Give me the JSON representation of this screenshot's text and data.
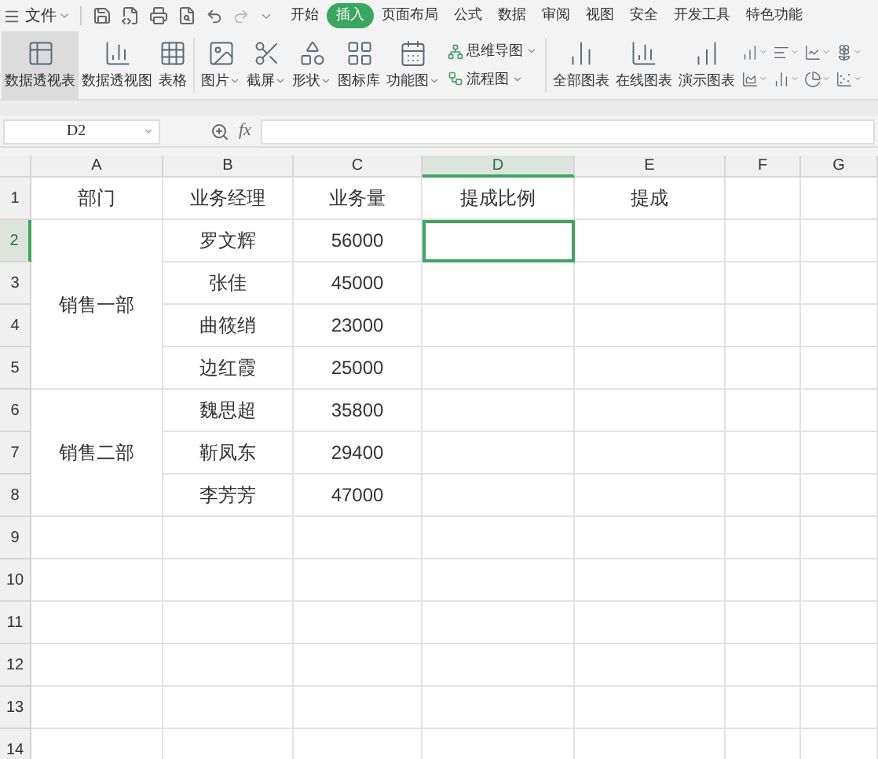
{
  "menu": {
    "file_label": "文件",
    "tabs": [
      {
        "label": "开始",
        "selected": false
      },
      {
        "label": "插入",
        "selected": true
      },
      {
        "label": "页面布局",
        "selected": false
      },
      {
        "label": "公式",
        "selected": false
      },
      {
        "label": "数据",
        "selected": false
      },
      {
        "label": "审阅",
        "selected": false
      },
      {
        "label": "视图",
        "selected": false
      },
      {
        "label": "安全",
        "selected": false
      },
      {
        "label": "开发工具",
        "selected": false
      },
      {
        "label": "特色功能",
        "selected": false
      }
    ]
  },
  "ribbon": {
    "large": [
      {
        "kind": "pivot-table",
        "label": "数据透视表",
        "selected": true,
        "dropdown": false
      },
      {
        "kind": "pivot-chart",
        "label": "数据透视图",
        "selected": false,
        "dropdown": false
      },
      {
        "kind": "table",
        "label": "表格",
        "selected": false,
        "dropdown": false
      },
      {
        "kind": "picture",
        "label": "图片",
        "selected": false,
        "dropdown": true
      },
      {
        "kind": "screenshot",
        "label": "截屏",
        "selected": false,
        "dropdown": true
      },
      {
        "kind": "shape",
        "label": "形状",
        "selected": false,
        "dropdown": true
      },
      {
        "kind": "icon-library",
        "label": "图标库",
        "selected": false,
        "dropdown": false
      },
      {
        "kind": "function-chart",
        "label": "功能图",
        "selected": false,
        "dropdown": true
      }
    ],
    "small": [
      {
        "kind": "mind-map",
        "label": "思维导图",
        "dropdown": true
      },
      {
        "kind": "flowchart",
        "label": "流程图",
        "dropdown": true
      }
    ],
    "charts": [
      {
        "kind": "all-charts",
        "label": "全部图表"
      },
      {
        "kind": "online-charts",
        "label": "在线图表"
      },
      {
        "kind": "demo-charts",
        "label": "演示图表"
      }
    ]
  },
  "formula_bar": {
    "cell_ref": "D2",
    "fx": "fx"
  },
  "sheet": {
    "columns": [
      {
        "label": "A",
        "selected": false
      },
      {
        "label": "B",
        "selected": false
      },
      {
        "label": "C",
        "selected": false
      },
      {
        "label": "D",
        "selected": true
      },
      {
        "label": "E",
        "selected": false
      },
      {
        "label": "F",
        "selected": false
      },
      {
        "label": "G",
        "selected": false
      }
    ],
    "rows": [
      {
        "label": "1",
        "selected": false
      },
      {
        "label": "2",
        "selected": true
      },
      {
        "label": "3",
        "selected": false
      },
      {
        "label": "4",
        "selected": false
      },
      {
        "label": "5",
        "selected": false
      },
      {
        "label": "6",
        "selected": false
      },
      {
        "label": "7",
        "selected": false
      },
      {
        "label": "8",
        "selected": false
      },
      {
        "label": "9",
        "selected": false
      },
      {
        "label": "10",
        "selected": false
      },
      {
        "label": "11",
        "selected": false
      },
      {
        "label": "12",
        "selected": false
      },
      {
        "label": "13",
        "selected": false
      },
      {
        "label": "14",
        "selected": false
      }
    ],
    "header": [
      "部门",
      "业务经理",
      "业务量",
      "提成比例",
      "提成"
    ],
    "departments": [
      {
        "name": "销售一部",
        "members": [
          {
            "manager": "罗文辉",
            "volume": "56000"
          },
          {
            "manager": "张佳",
            "volume": "45000"
          },
          {
            "manager": "曲筱绡",
            "volume": "23000"
          },
          {
            "manager": "边红霞",
            "volume": "25000"
          }
        ]
      },
      {
        "name": "销售二部",
        "members": [
          {
            "manager": "魏思超",
            "volume": "35800"
          },
          {
            "manager": "靳凤东",
            "volume": "29400"
          },
          {
            "manager": "李芳芳",
            "volume": "47000"
          }
        ]
      }
    ]
  }
}
